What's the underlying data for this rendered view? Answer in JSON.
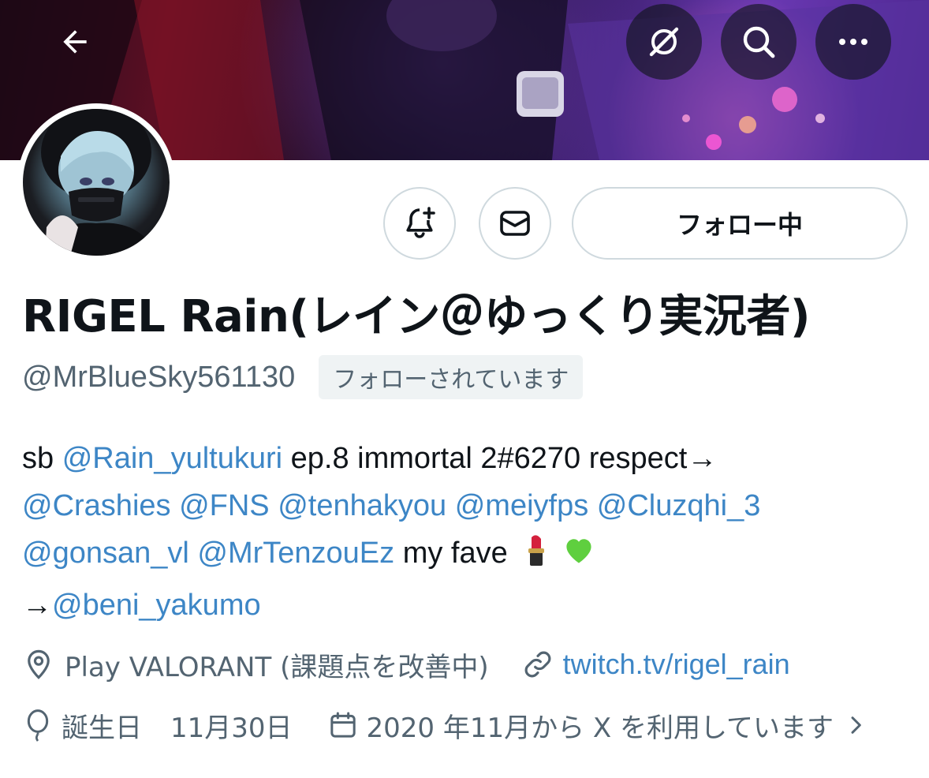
{
  "header": {
    "back_icon": "arrow-left-icon",
    "grok_icon": "grok-icon",
    "search_icon": "search-icon",
    "more_icon": "more-horizontal-icon"
  },
  "profile": {
    "display_name": "RIGEL Rain(レイン＠ゆっくり実況者)",
    "handle": "@MrBlueSky561130",
    "follows_you_badge": "フォローされています",
    "following_button": "フォロー中",
    "notify_icon": "bell-plus-icon",
    "message_icon": "mail-icon"
  },
  "bio": {
    "line1_prefix": "sb ",
    "line1_mention": "@Rain_yultukuri",
    "line1_suffix": " ep.8 immortal 2#6270 respect→",
    "line2_mentions": [
      "@Crashies",
      "@FNS",
      "@tenhakyou",
      "@meiyfps",
      "@Cluzqhi_3"
    ],
    "line3_mentions": [
      "@gonsan_vl",
      "@MrTenzouEz"
    ],
    "line3_suffix": " my fave ",
    "emojis": [
      "lipstick-emoji",
      "green-heart-emoji"
    ],
    "line4_prefix": "→",
    "line4_mention": "@beni_yakumo"
  },
  "meta": {
    "location_icon": "location-pin-icon",
    "location": "Play VALORANT (課題点を改善中)",
    "link_icon": "link-icon",
    "link": "twitch.tv/rigel_rain",
    "birthday_icon": "balloon-icon",
    "birthday_label": "誕生日",
    "birthday_value": "11月30日",
    "calendar_icon": "calendar-icon",
    "joined": "2020 年11月から X を利用しています",
    "chevron_icon": "chevron-right-icon"
  },
  "colors": {
    "link": "#3d86c6",
    "secondary_text": "#536471",
    "border": "#cfd9de"
  }
}
